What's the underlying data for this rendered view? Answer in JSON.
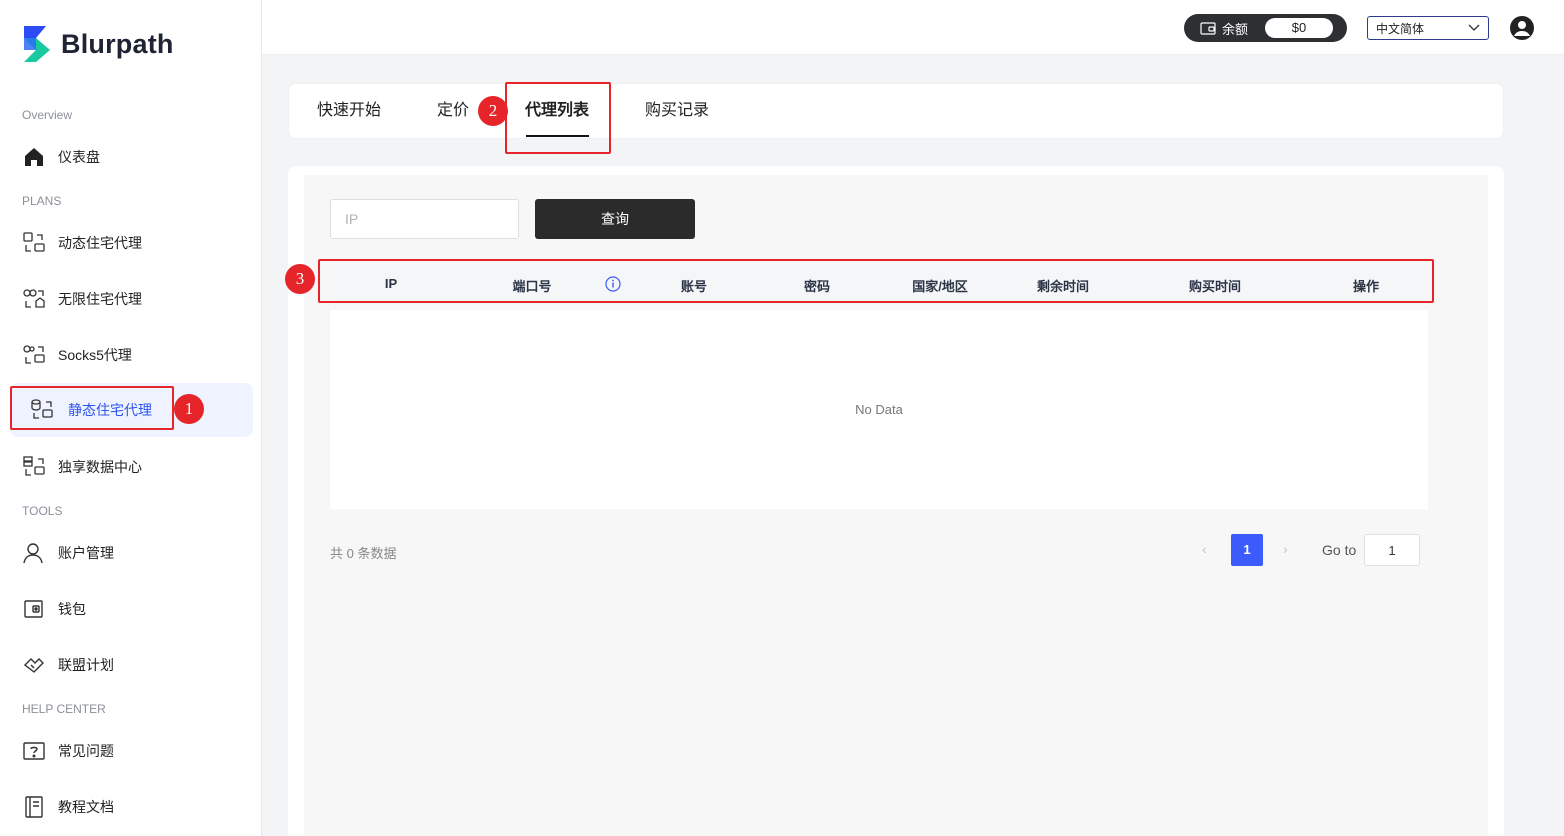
{
  "brand": {
    "name": "Blurpath"
  },
  "sidebar": {
    "sections": [
      "Overview",
      "PLANS",
      "TOOLS",
      "HELP CENTER"
    ],
    "items": [
      {
        "label": "仪表盘",
        "icon": "home-icon"
      },
      {
        "label": "动态住宅代理",
        "icon": "rotating-residential-icon"
      },
      {
        "label": "无限住宅代理",
        "icon": "unlimited-residential-icon"
      },
      {
        "label": "Socks5代理",
        "icon": "socks5-icon"
      },
      {
        "label": "静态住宅代理",
        "icon": "static-residential-icon",
        "active": true
      },
      {
        "label": "独享数据中心",
        "icon": "datacenter-icon"
      },
      {
        "label": "账户管理",
        "icon": "user-icon"
      },
      {
        "label": "钱包",
        "icon": "wallet-icon"
      },
      {
        "label": "联盟计划",
        "icon": "affiliate-icon"
      },
      {
        "label": "常见问题",
        "icon": "faq-icon"
      },
      {
        "label": "教程文档",
        "icon": "docs-icon"
      }
    ]
  },
  "topbar": {
    "balance_label": "余额",
    "balance_amount": "$0",
    "language": "中文简体"
  },
  "tabs": [
    {
      "label": "快速开始"
    },
    {
      "label": "定价"
    },
    {
      "label": "代理列表",
      "active": true
    },
    {
      "label": "购买记录"
    }
  ],
  "search": {
    "placeholder": "IP",
    "button": "查询"
  },
  "table": {
    "columns": [
      "IP",
      "端口号",
      "账号",
      "密码",
      "国家/地区",
      "剩余时间",
      "购买时间",
      "操作"
    ],
    "empty_text": "No Data"
  },
  "pagination": {
    "total_text": "共 0 条数据",
    "current_page": "1",
    "goto_label": "Go to",
    "goto_value": "1",
    "prev": "‹",
    "next": "›"
  },
  "annotations": [
    "1",
    "2",
    "3"
  ],
  "colors": {
    "accent": "#3b5bfd",
    "highlight": "#e5252a",
    "active_bg": "#eef3ff",
    "dark_button": "#2b2b2b"
  }
}
